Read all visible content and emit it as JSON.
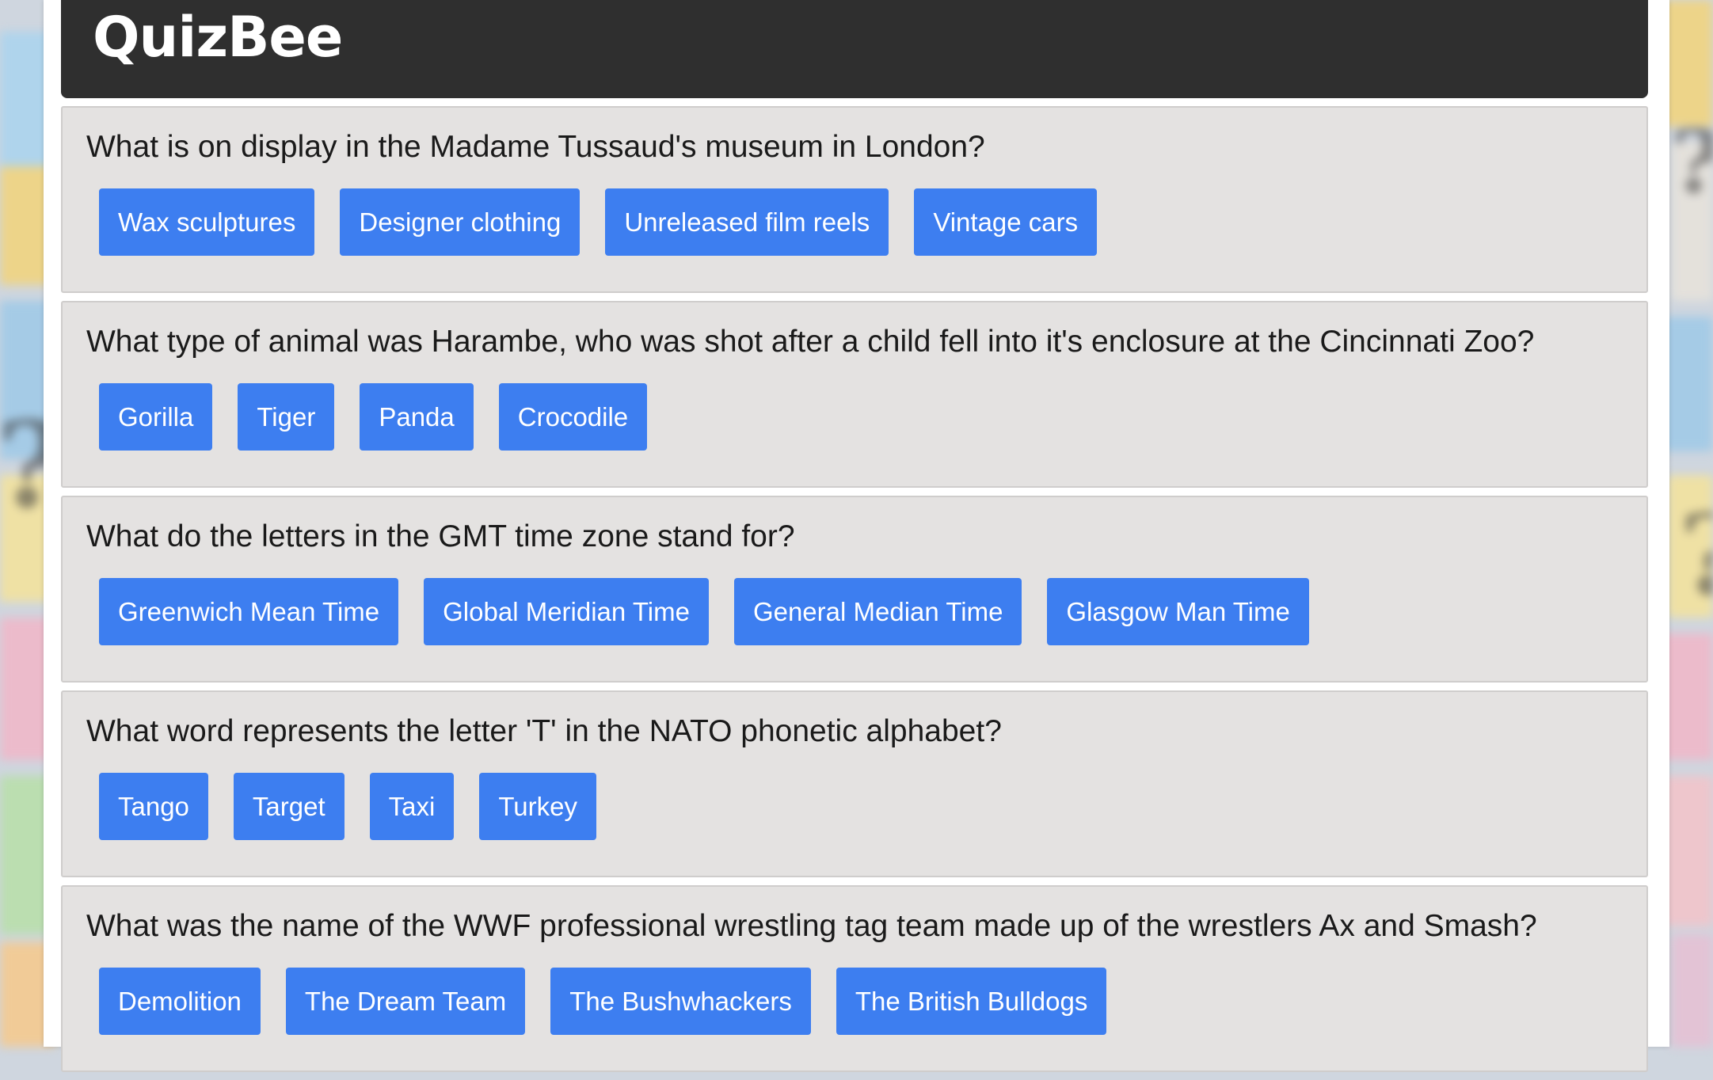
{
  "app": {
    "logo": "QuizBee"
  },
  "questions": [
    {
      "text": "What is on display in the Madame Tussaud's museum in London?",
      "answers": [
        "Wax sculptures",
        "Designer clothing",
        "Unreleased film reels",
        "Vintage cars"
      ]
    },
    {
      "text": "What type of animal was Harambe, who was shot after a child fell into it's enclosure at the Cincinnati Zoo?",
      "answers": [
        "Gorilla",
        "Tiger",
        "Panda",
        "Crocodile"
      ]
    },
    {
      "text": "What do the letters in the GMT time zone stand for?",
      "answers": [
        "Greenwich Mean Time",
        "Global Meridian Time",
        "General Median Time",
        "Glasgow Man Time"
      ]
    },
    {
      "text": "What word represents the letter 'T' in the NATO phonetic alphabet?",
      "answers": [
        "Tango",
        "Target",
        "Taxi",
        "Turkey"
      ]
    },
    {
      "text": "What was the name of the WWF professional wrestling tag team made up of the wrestlers Ax and Smash?",
      "answers": [
        "Demolition",
        "The Dream Team",
        "The Bushwhackers",
        "The British Bulldogs"
      ]
    }
  ],
  "colors": {
    "header_bg": "#2f2f2f",
    "card_bg": "#e4e2e1",
    "button_bg": "#3d7ef0",
    "button_text": "#ffffff"
  }
}
